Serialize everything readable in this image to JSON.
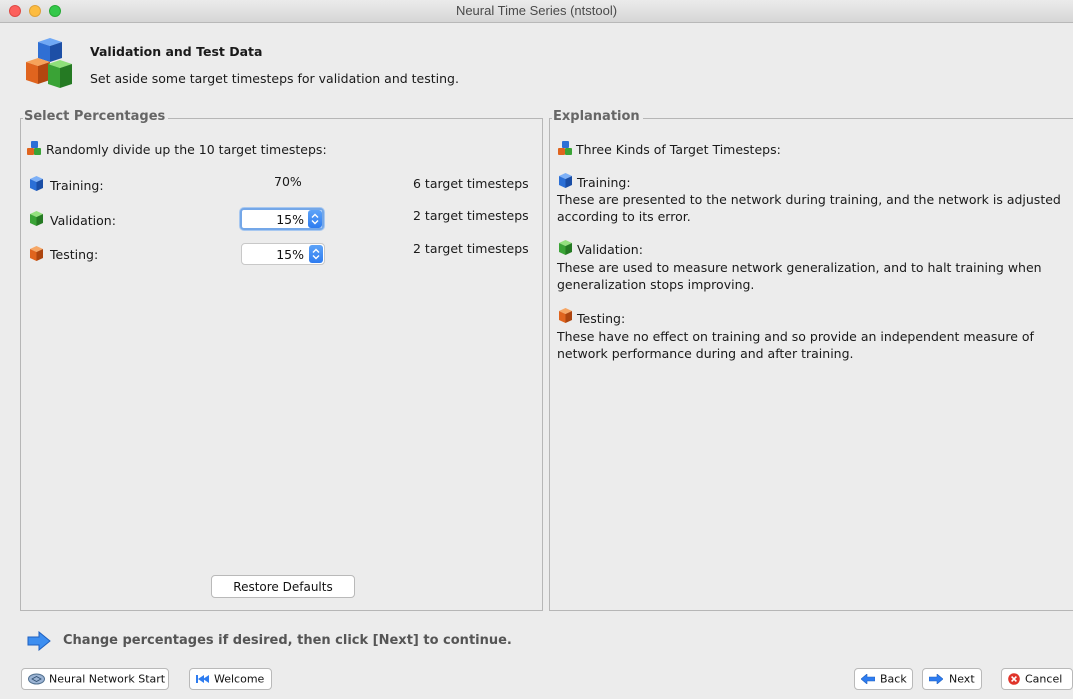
{
  "window": {
    "title": "Neural Time Series (ntstool)"
  },
  "header": {
    "title": "Validation and Test Data",
    "subtitle": "Set aside some target timesteps for validation and testing.",
    "icon": "cubes-icon"
  },
  "select_panel": {
    "legend": "Select Percentages",
    "intro": "Randomly divide up the 10 target timesteps:",
    "rows": [
      {
        "label": "Training:",
        "value": "70%",
        "timesteps": "6 target timesteps",
        "color": "#2b6fd6",
        "editable": false
      },
      {
        "label": "Validation:",
        "value": "15%",
        "timesteps": "2 target timesteps",
        "color": "#3aa336",
        "editable": true
      },
      {
        "label": "Testing:",
        "value": "15%",
        "timesteps": "2 target timesteps",
        "color": "#e0641e",
        "editable": true
      }
    ],
    "restore_label": "Restore Defaults"
  },
  "explanation_panel": {
    "legend": "Explanation",
    "intro": "Three Kinds of Target Timesteps:",
    "sections": [
      {
        "title": "Training:",
        "body": "These are presented to the network during training, and the network is adjusted according to its error.",
        "color": "#2b6fd6"
      },
      {
        "title": "Validation:",
        "body": "These are used to measure network generalization, and to halt training when generalization stops improving.",
        "color": "#3aa336"
      },
      {
        "title": "Testing:",
        "body": "These have no effect on training and so provide an independent measure of network performance during and after training.",
        "color": "#e0641e"
      }
    ]
  },
  "hint": "Change percentages if desired, then click [Next] to continue.",
  "footer": {
    "nn_start": "Neural Network Start",
    "welcome": "Welcome",
    "back": "Back",
    "next": "Next",
    "cancel": "Cancel"
  },
  "colors": {
    "accent": "#2e7cf0",
    "panel_border": "#b6b6b6",
    "background": "#ececec"
  }
}
